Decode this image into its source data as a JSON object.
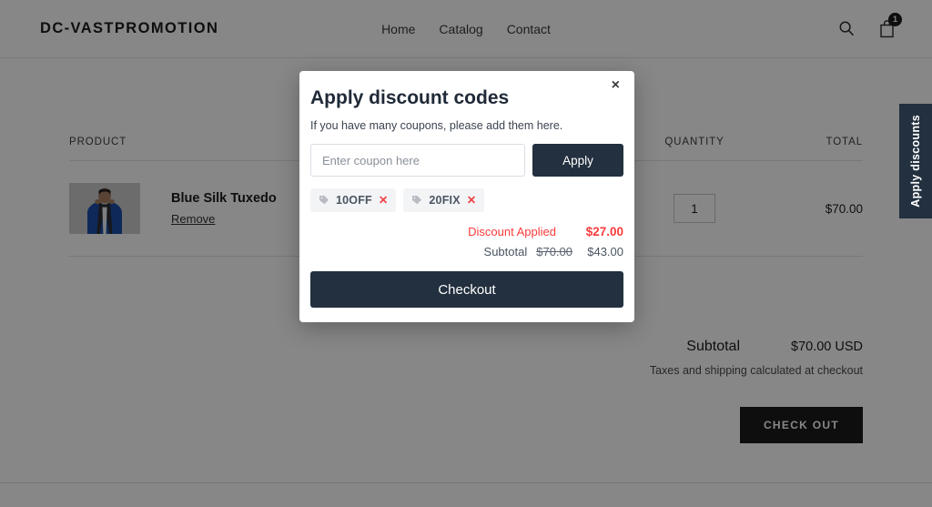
{
  "header": {
    "logo": "DC-VASTPROMOTION",
    "nav": [
      {
        "label": "Home"
      },
      {
        "label": "Catalog"
      },
      {
        "label": "Contact"
      }
    ],
    "search_icon": "search-icon",
    "cart_icon": "shopping-bag-icon",
    "cart_count": "1"
  },
  "cart": {
    "columns": {
      "product": "PRODUCT",
      "quantity": "QUANTITY",
      "total": "TOTAL"
    },
    "items": [
      {
        "title": "Blue Silk Tuxedo",
        "remove_label": "Remove",
        "quantity": "1",
        "total": "$70.00"
      }
    ],
    "summary": {
      "subtotal_label": "Subtotal",
      "subtotal_value": "$70.00 USD",
      "note": "Taxes and shipping calculated at checkout",
      "checkout_label": "CHECK OUT"
    }
  },
  "side_tab": {
    "label": "Apply discounts"
  },
  "modal": {
    "title": "Apply discount codes",
    "subtitle": "If you have many coupons, please add them here.",
    "close_label": "×",
    "input_placeholder": "Enter coupon here",
    "input_value": "",
    "apply_label": "Apply",
    "coupons": [
      {
        "code": "10OFF",
        "remove_label": "✕"
      },
      {
        "code": "20FIX",
        "remove_label": "✕"
      }
    ],
    "discount_label": "Discount Applied",
    "discount_value": "$27.00",
    "subtotal_label": "Subtotal",
    "subtotal_original": "$70.00",
    "subtotal_value": "$43.00",
    "checkout_label": "Checkout"
  },
  "colors": {
    "dark": "#22303f",
    "danger": "#fb3b3b",
    "chip_bg": "#f3f4f6",
    "button_dark": "#1c1c1c"
  }
}
